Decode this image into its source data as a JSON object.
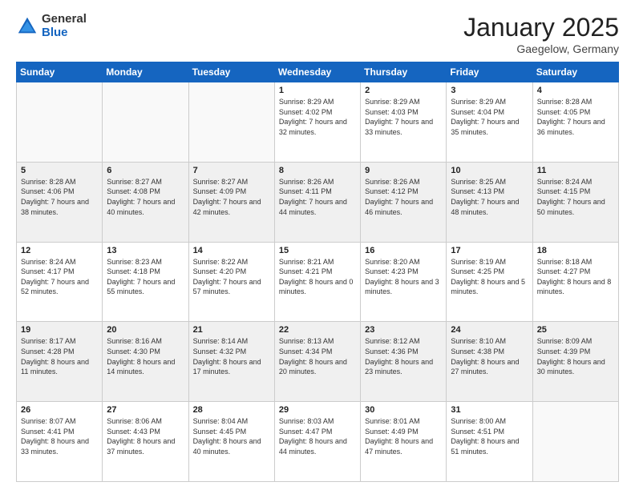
{
  "logo": {
    "general": "General",
    "blue": "Blue"
  },
  "header": {
    "month": "January 2025",
    "location": "Gaegelow, Germany"
  },
  "days": [
    "Sunday",
    "Monday",
    "Tuesday",
    "Wednesday",
    "Thursday",
    "Friday",
    "Saturday"
  ],
  "weeks": [
    {
      "shade": "white",
      "cells": [
        {
          "day": "",
          "text": ""
        },
        {
          "day": "",
          "text": ""
        },
        {
          "day": "",
          "text": ""
        },
        {
          "day": "1",
          "text": "Sunrise: 8:29 AM\nSunset: 4:02 PM\nDaylight: 7 hours and 32 minutes."
        },
        {
          "day": "2",
          "text": "Sunrise: 8:29 AM\nSunset: 4:03 PM\nDaylight: 7 hours and 33 minutes."
        },
        {
          "day": "3",
          "text": "Sunrise: 8:29 AM\nSunset: 4:04 PM\nDaylight: 7 hours and 35 minutes."
        },
        {
          "day": "4",
          "text": "Sunrise: 8:28 AM\nSunset: 4:05 PM\nDaylight: 7 hours and 36 minutes."
        }
      ]
    },
    {
      "shade": "shaded",
      "cells": [
        {
          "day": "5",
          "text": "Sunrise: 8:28 AM\nSunset: 4:06 PM\nDaylight: 7 hours and 38 minutes."
        },
        {
          "day": "6",
          "text": "Sunrise: 8:27 AM\nSunset: 4:08 PM\nDaylight: 7 hours and 40 minutes."
        },
        {
          "day": "7",
          "text": "Sunrise: 8:27 AM\nSunset: 4:09 PM\nDaylight: 7 hours and 42 minutes."
        },
        {
          "day": "8",
          "text": "Sunrise: 8:26 AM\nSunset: 4:11 PM\nDaylight: 7 hours and 44 minutes."
        },
        {
          "day": "9",
          "text": "Sunrise: 8:26 AM\nSunset: 4:12 PM\nDaylight: 7 hours and 46 minutes."
        },
        {
          "day": "10",
          "text": "Sunrise: 8:25 AM\nSunset: 4:13 PM\nDaylight: 7 hours and 48 minutes."
        },
        {
          "day": "11",
          "text": "Sunrise: 8:24 AM\nSunset: 4:15 PM\nDaylight: 7 hours and 50 minutes."
        }
      ]
    },
    {
      "shade": "white",
      "cells": [
        {
          "day": "12",
          "text": "Sunrise: 8:24 AM\nSunset: 4:17 PM\nDaylight: 7 hours and 52 minutes."
        },
        {
          "day": "13",
          "text": "Sunrise: 8:23 AM\nSunset: 4:18 PM\nDaylight: 7 hours and 55 minutes."
        },
        {
          "day": "14",
          "text": "Sunrise: 8:22 AM\nSunset: 4:20 PM\nDaylight: 7 hours and 57 minutes."
        },
        {
          "day": "15",
          "text": "Sunrise: 8:21 AM\nSunset: 4:21 PM\nDaylight: 8 hours and 0 minutes."
        },
        {
          "day": "16",
          "text": "Sunrise: 8:20 AM\nSunset: 4:23 PM\nDaylight: 8 hours and 3 minutes."
        },
        {
          "day": "17",
          "text": "Sunrise: 8:19 AM\nSunset: 4:25 PM\nDaylight: 8 hours and 5 minutes."
        },
        {
          "day": "18",
          "text": "Sunrise: 8:18 AM\nSunset: 4:27 PM\nDaylight: 8 hours and 8 minutes."
        }
      ]
    },
    {
      "shade": "shaded",
      "cells": [
        {
          "day": "19",
          "text": "Sunrise: 8:17 AM\nSunset: 4:28 PM\nDaylight: 8 hours and 11 minutes."
        },
        {
          "day": "20",
          "text": "Sunrise: 8:16 AM\nSunset: 4:30 PM\nDaylight: 8 hours and 14 minutes."
        },
        {
          "day": "21",
          "text": "Sunrise: 8:14 AM\nSunset: 4:32 PM\nDaylight: 8 hours and 17 minutes."
        },
        {
          "day": "22",
          "text": "Sunrise: 8:13 AM\nSunset: 4:34 PM\nDaylight: 8 hours and 20 minutes."
        },
        {
          "day": "23",
          "text": "Sunrise: 8:12 AM\nSunset: 4:36 PM\nDaylight: 8 hours and 23 minutes."
        },
        {
          "day": "24",
          "text": "Sunrise: 8:10 AM\nSunset: 4:38 PM\nDaylight: 8 hours and 27 minutes."
        },
        {
          "day": "25",
          "text": "Sunrise: 8:09 AM\nSunset: 4:39 PM\nDaylight: 8 hours and 30 minutes."
        }
      ]
    },
    {
      "shade": "white",
      "cells": [
        {
          "day": "26",
          "text": "Sunrise: 8:07 AM\nSunset: 4:41 PM\nDaylight: 8 hours and 33 minutes."
        },
        {
          "day": "27",
          "text": "Sunrise: 8:06 AM\nSunset: 4:43 PM\nDaylight: 8 hours and 37 minutes."
        },
        {
          "day": "28",
          "text": "Sunrise: 8:04 AM\nSunset: 4:45 PM\nDaylight: 8 hours and 40 minutes."
        },
        {
          "day": "29",
          "text": "Sunrise: 8:03 AM\nSunset: 4:47 PM\nDaylight: 8 hours and 44 minutes."
        },
        {
          "day": "30",
          "text": "Sunrise: 8:01 AM\nSunset: 4:49 PM\nDaylight: 8 hours and 47 minutes."
        },
        {
          "day": "31",
          "text": "Sunrise: 8:00 AM\nSunset: 4:51 PM\nDaylight: 8 hours and 51 minutes."
        },
        {
          "day": "",
          "text": ""
        }
      ]
    }
  ]
}
